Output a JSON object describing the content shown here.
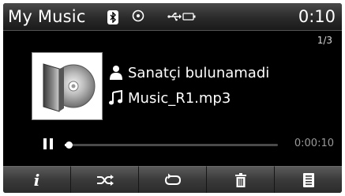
{
  "header": {
    "title": "My Music",
    "clock": "0:10",
    "icons": [
      "bluetooth-icon",
      "disc-icon",
      "usb-icon",
      "battery-icon"
    ]
  },
  "track": {
    "index": "1/3",
    "artist": "Sanatçi bulunamadi",
    "filename": "Music_R1.mp3",
    "elapsed": "0:00:10",
    "progress": 0.02
  },
  "toolbar": {
    "info_label": "i",
    "buttons": [
      "info",
      "shuffle",
      "repeat",
      "delete",
      "list"
    ]
  },
  "colors": {
    "background": "#000000",
    "text": "#ffffff",
    "muted": "#9a9a9a"
  }
}
